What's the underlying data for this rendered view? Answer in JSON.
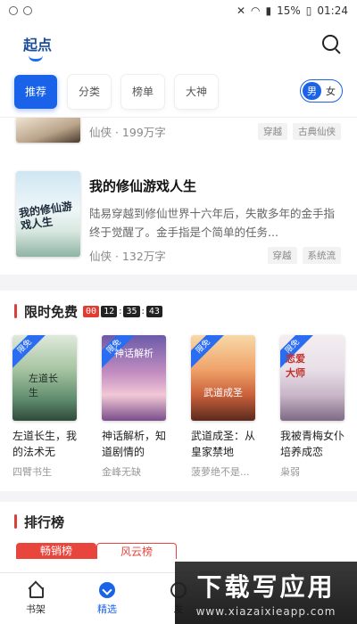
{
  "status_bar": {
    "battery": "15%",
    "time": "01:24"
  },
  "header": {
    "title": "起点"
  },
  "tabs": [
    {
      "label": "推荐",
      "active": true
    },
    {
      "label": "分类",
      "active": false
    },
    {
      "label": "榜单",
      "active": false
    },
    {
      "label": "大神",
      "active": false
    }
  ],
  "gender": {
    "male": "男",
    "female": "女",
    "selected": "男"
  },
  "partial_book": {
    "meta": "仙侠 · 199万字",
    "tags": [
      "穿越",
      "古典仙侠"
    ]
  },
  "book": {
    "title": "我的修仙游戏人生",
    "desc": "陆易穿越到修仙世界十六年后，失散多年的金手指终于觉醒了。金手指是个简单的任务...",
    "meta": "仙侠 · 132万字",
    "tags": [
      "穿越",
      "系统流"
    ],
    "cover_text": "我的修仙游戏人生"
  },
  "free_section": {
    "title": "限时免费",
    "timer": [
      "00",
      "12",
      "35",
      "43"
    ],
    "ribbon": "限免",
    "books": [
      {
        "title": "左道长生，我的法术无",
        "author": "四臂书生",
        "cover_text": "左道长生"
      },
      {
        "title": "神话解析，知道剧情的",
        "author": "金峰无缺",
        "cover_text": "神话解析"
      },
      {
        "title": "武道成圣：从皇家禁地",
        "author": "菠萝绝不是...",
        "cover_text": "武道成圣"
      },
      {
        "title": "我被青梅女仆培养成恋",
        "author": "枭弱",
        "cover_text": "恋爱大师"
      }
    ]
  },
  "rank_section": {
    "title": "排行榜",
    "tabs": [
      {
        "label": "畅销榜",
        "active": true
      },
      {
        "label": "风云榜",
        "active": false
      }
    ]
  },
  "bottom_nav": [
    {
      "label": "书架",
      "active": false
    },
    {
      "label": "精选",
      "active": true
    },
    {
      "label": "发",
      "active": false
    }
  ],
  "watermark": {
    "title": "下载写应用",
    "url": "www.xiazaixieapp.com"
  }
}
